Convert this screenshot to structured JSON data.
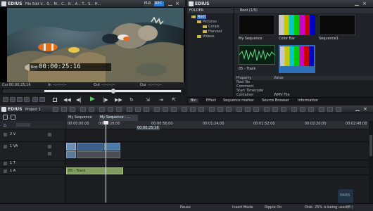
{
  "player": {
    "app_title": "EDIUS",
    "title_file": "File Edit V... O... M... C... R... A... T... S... H...",
    "mode_plr": "PLR",
    "mode_rec": "REC",
    "timecode": "00:00:25:16",
    "tc_label": "Rcd",
    "cur_label": "Cur",
    "cur_value": "00:00:25;16",
    "in_label": "In",
    "in_value": "--:--:--;--",
    "out_label": "Out",
    "out_value": "--:--:--;--",
    "dur_label": "Dur",
    "dur_value": "--:--:--;--",
    "scrub_progress": 0.62
  },
  "bin": {
    "title": "EDIUS",
    "folder_header": "FOLDER",
    "folders": [
      "Root",
      "Pictures",
      "Corals",
      "Harvest",
      "Videos"
    ],
    "path": "Root (1/5)",
    "clips": [
      {
        "name": "My Sequence",
        "type": "sequence"
      },
      {
        "name": "Color Bar",
        "type": "colorbar"
      },
      {
        "name": "Sequence1",
        "type": "sequence"
      },
      {
        "name": "05 - Track",
        "type": "audio"
      },
      {
        "name": "",
        "type": "colorbar"
      }
    ],
    "props": [
      [
        "Property",
        "Value"
      ],
      [
        "Reel No",
        ""
      ],
      [
        "Comment",
        ""
      ],
      [
        "Start Timecode",
        ""
      ],
      [
        "Container",
        "WMV File"
      ]
    ],
    "tabs": [
      "Bin",
      "Effect",
      "Sequence marker",
      "Source Browser",
      "Information"
    ]
  },
  "timeline": {
    "app_title": "EDIUS",
    "project": "Project 1",
    "tabs": [
      "My Sequence",
      "My Sequence - ..."
    ],
    "ruler": [
      "00:00:00;00",
      "00:00:28;00",
      "00:00:56;00",
      "00:01:24;00",
      "00:01:52;00",
      "00:02:20;00",
      "00:02:48;00"
    ],
    "ruler_tip": "00:00:25;16",
    "tracks": [
      {
        "name": "2 V"
      },
      {
        "name": "1 VA"
      },
      {
        "name": "1 T"
      },
      {
        "name": "1 A"
      }
    ],
    "audio_clip": "05 - Track",
    "status": [
      "Pause",
      "Insert Mode",
      "Ripple On",
      "Disk: 25% is being used(E:)"
    ],
    "watermark": "PARS"
  }
}
